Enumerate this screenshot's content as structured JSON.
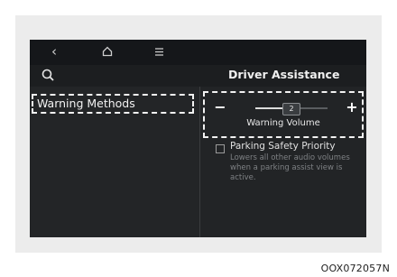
{
  "topbar": {
    "back_icon": "chevron-left-icon",
    "home_icon": "home-icon",
    "menu_icon": "menu-icon"
  },
  "header": {
    "search_icon": "search-icon",
    "title": "Driver Assistance"
  },
  "sidebar": {
    "items": [
      {
        "label": "Warning Methods",
        "selected": true
      }
    ]
  },
  "warning_volume": {
    "minus_label": "−",
    "plus_label": "+",
    "value": "2",
    "level_fraction": 0.5,
    "label": "Warning Volume"
  },
  "parking_priority": {
    "label": "Parking Safety Priority",
    "checked": false,
    "description": "Lowers all other audio volumes when a parking assist view is active."
  },
  "figure_code": "OOX072057N",
  "colors": {
    "screen_bg": "#222426",
    "highlight_border": "#f2f2f2",
    "muted_text": "#7e8184"
  }
}
